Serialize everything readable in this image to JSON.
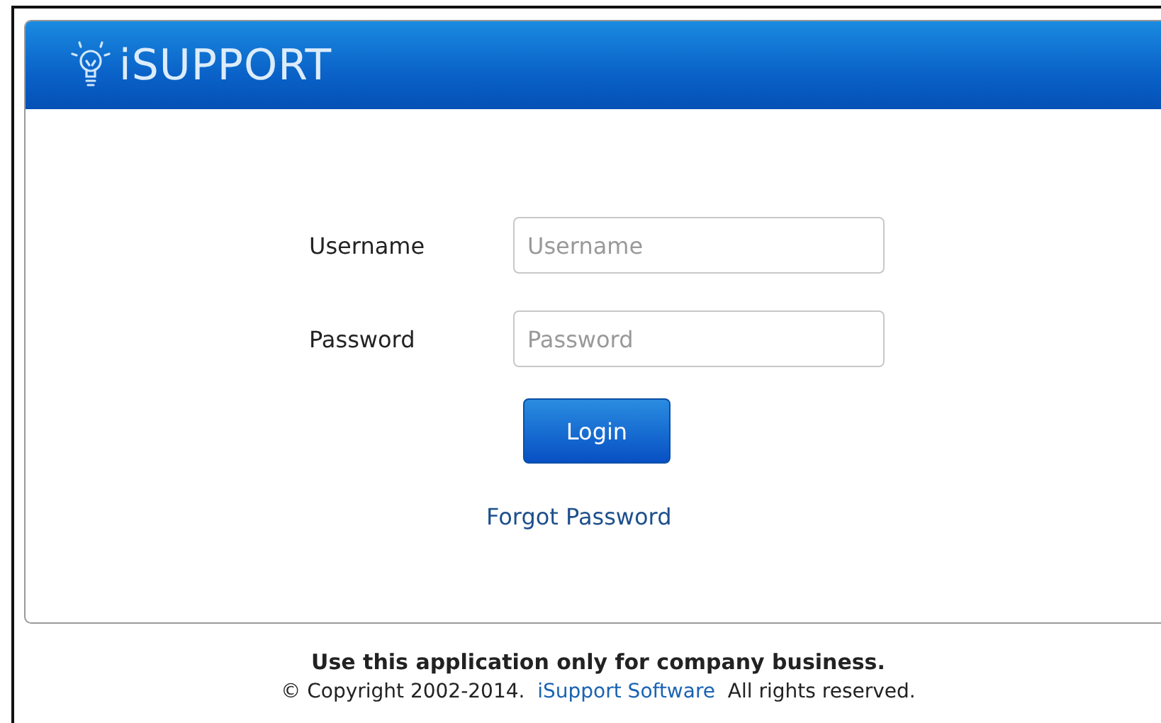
{
  "header": {
    "title": "iSUPPORT"
  },
  "form": {
    "fields": [
      {
        "label": "Username",
        "placeholder": "Username"
      },
      {
        "label": "Password",
        "placeholder": "Password"
      }
    ],
    "login_button": "Login",
    "forgot_link": "Forgot Password"
  },
  "footer": {
    "notice": "Use this application only for company business.",
    "copyright_before": "© Copyright 2002-2014.",
    "copyright_link": "iSupport Software",
    "copyright_after": "All rights reserved."
  }
}
